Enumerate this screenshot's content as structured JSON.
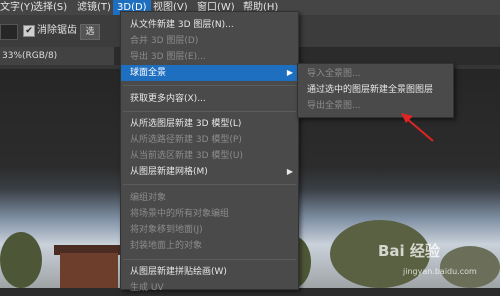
{
  "menubar": {
    "items": [
      "文字(Y)",
      "选择(S)",
      "滤镜(T)",
      "3D(D)",
      "视图(V)",
      "窗口(W)",
      "帮助(H)"
    ],
    "active_index": 3
  },
  "options": {
    "antialias_label": "消除锯齿",
    "antialias_checked": "✔",
    "button_label": "选"
  },
  "document": {
    "tab_label": "33%(RGB/8)"
  },
  "menu_3d": {
    "items": [
      {
        "label": "从文件新建 3D 图层(N)...",
        "disabled": false
      },
      {
        "label": "合并 3D 图层(D)",
        "disabled": true
      },
      {
        "label": "导出 3D 图层(E)...",
        "disabled": true
      },
      {
        "label": "球面全景",
        "disabled": false,
        "highlighted": true,
        "submenu_arrow": "▶"
      },
      {
        "label": "获取更多内容(X)...",
        "disabled": false
      },
      {
        "label": "从所选图层新建 3D 模型(L)",
        "disabled": false
      },
      {
        "label": "从所选路径新建 3D 模型(P)",
        "disabled": true
      },
      {
        "label": "从当前选区新建 3D 模型(U)",
        "disabled": true
      },
      {
        "label": "从图层新建网格(M)",
        "disabled": false,
        "submenu_arrow": "▶"
      },
      {
        "label": "编组对象",
        "disabled": true
      },
      {
        "label": "将场景中的所有对象编组",
        "disabled": true
      },
      {
        "label": "将对象移到地面(J)",
        "disabled": true
      },
      {
        "label": "封装地面上的对象",
        "disabled": true
      },
      {
        "label": "从图层新建拼贴绘画(W)",
        "disabled": false
      },
      {
        "label": "生成 UV",
        "disabled": true
      }
    ]
  },
  "submenu_panorama": {
    "items": [
      {
        "label": "导入全景图...",
        "disabled": true
      },
      {
        "label": "通过选中的图层新建全景图图层",
        "disabled": false
      },
      {
        "label": "导出全景图...",
        "disabled": true
      }
    ]
  },
  "watermark": {
    "text": "Bai 经验",
    "subtext": "jingyan.baidu.com"
  },
  "colors": {
    "highlight": "#1f6fc1",
    "annotation_arrow": "#e02424",
    "menu_bg": "#4a4a4a"
  }
}
